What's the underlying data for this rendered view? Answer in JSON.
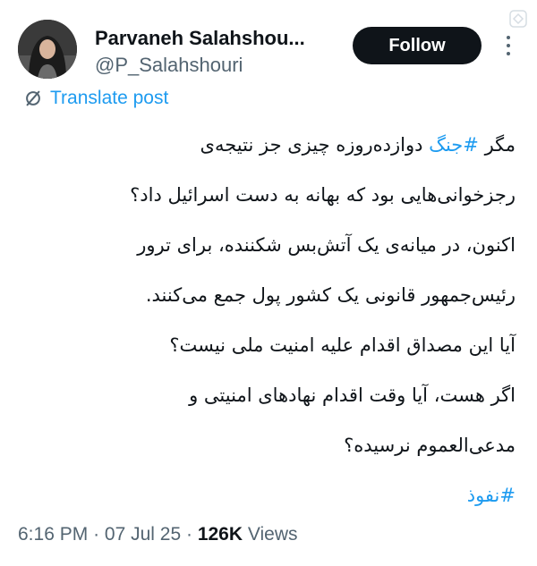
{
  "author": {
    "name": "Parvaneh Salahshou...",
    "handle": "@P_Salahshouri",
    "follow_label": "Follow"
  },
  "translate": {
    "label": "Translate post",
    "icon": "translate-icon"
  },
  "tweet": {
    "lines": [
      {
        "before": "مگر ",
        "hashtag": "#جنگ",
        "after": " دوازده‌روزه چیزی جز نتیجه‌ی"
      },
      {
        "text": "رجزخوانی‌هایی بود که بهانه به دست اسرائیل داد؟"
      },
      {
        "text": "اکنون، در میانه‌ی یک آتش‌بس شکننده، برای ترور"
      },
      {
        "text": "رئیس‌جمهور قانونی یک کشور پول جمع می‌کنند."
      },
      {
        "text": "آیا این مصداق اقدام علیه امنیت ملی نیست؟"
      },
      {
        "text": "اگر هست، آیا وقت اقدام نهادهای امنیتی و"
      },
      {
        "text": "مدعی‌العموم نرسیده؟"
      }
    ],
    "trailing_hashtag": "#نفوذ"
  },
  "meta": {
    "time": "6:16 PM",
    "date": "07 Jul 25",
    "views_count": "126K",
    "views_label": "Views",
    "separator": "·"
  },
  "colors": {
    "accent": "#1d9bf0",
    "text": "#0f1419",
    "muted": "#536471"
  }
}
